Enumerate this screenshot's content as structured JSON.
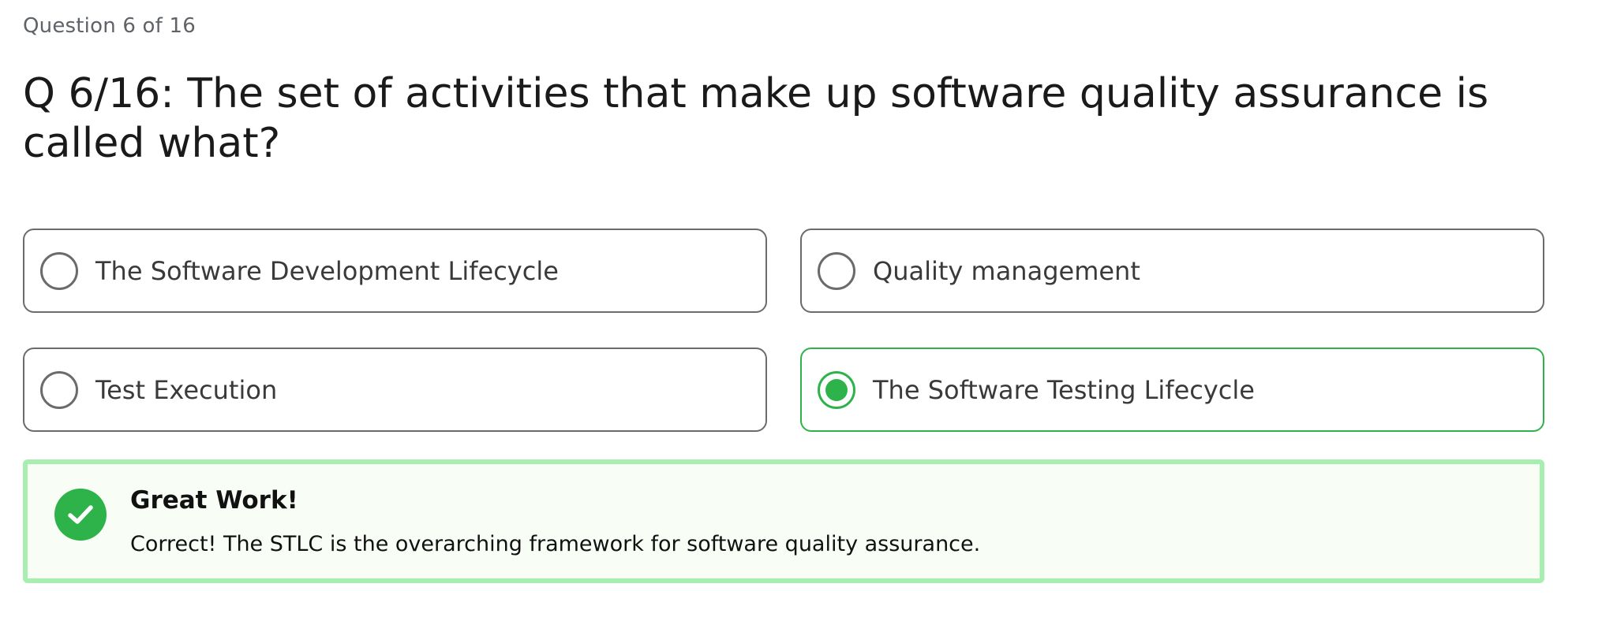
{
  "quiz": {
    "progress": "Question 6 of 16",
    "question": "Q 6/16: The set of activities that make up software quality assurance is called what?",
    "options": [
      {
        "label": "The Software Development Lifecycle",
        "selected": false
      },
      {
        "label": "Quality management",
        "selected": false
      },
      {
        "label": "Test Execution",
        "selected": false
      },
      {
        "label": "The Software Testing Lifecycle",
        "selected": true
      }
    ],
    "feedback": {
      "title": "Great Work!",
      "message": "Correct! The STLC is the overarching framework for software quality assurance.",
      "icon": "check-icon",
      "status": "correct"
    }
  },
  "colors": {
    "accent_green": "#2eb34a",
    "feedback_border": "#a8eeb0",
    "feedback_background": "#f8fdf6",
    "option_border": "#6b6b6b"
  }
}
